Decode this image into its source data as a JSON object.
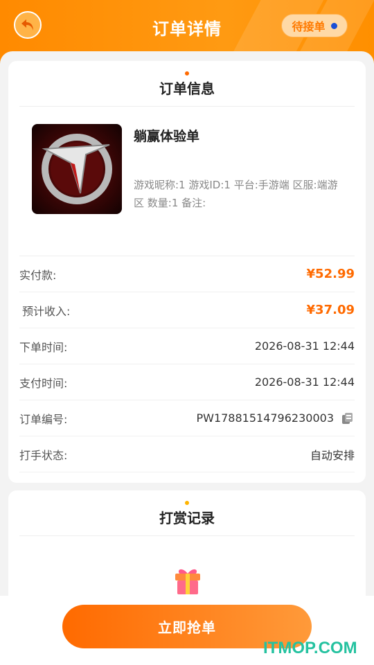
{
  "header": {
    "title": "订单详情",
    "status": "待接单"
  },
  "order_card": {
    "title": "订单信息",
    "product": {
      "name": "躺赢体验单",
      "description": "游戏昵称:1 游戏ID:1 平台:手游端 区服:端游区 数量:1 备注:"
    },
    "rows": [
      {
        "label": "实付款:",
        "value": "¥52.99"
      },
      {
        "label": "预计收入:",
        "value": "¥37.09"
      },
      {
        "label": "下单时间:",
        "value": "2026-08-31 12:44"
      },
      {
        "label": "支付时间:",
        "value": "2026-08-31 12:44"
      },
      {
        "label": "订单编号:",
        "value": "PW17881514796230003"
      },
      {
        "label": "打手状态:",
        "value": "自动安排"
      }
    ]
  },
  "reward_card": {
    "title": "打赏记录"
  },
  "action": {
    "grab_label": "立即抢单"
  },
  "watermark": "ITMOP.COM",
  "colors": {
    "accent": "#ff8a00",
    "price": "#ff6a00",
    "status_dot": "#1a4fd6",
    "watermark": "#25c2a0"
  },
  "icons": [
    "back-arrow-icon",
    "copy-icon",
    "gift-icon"
  ]
}
